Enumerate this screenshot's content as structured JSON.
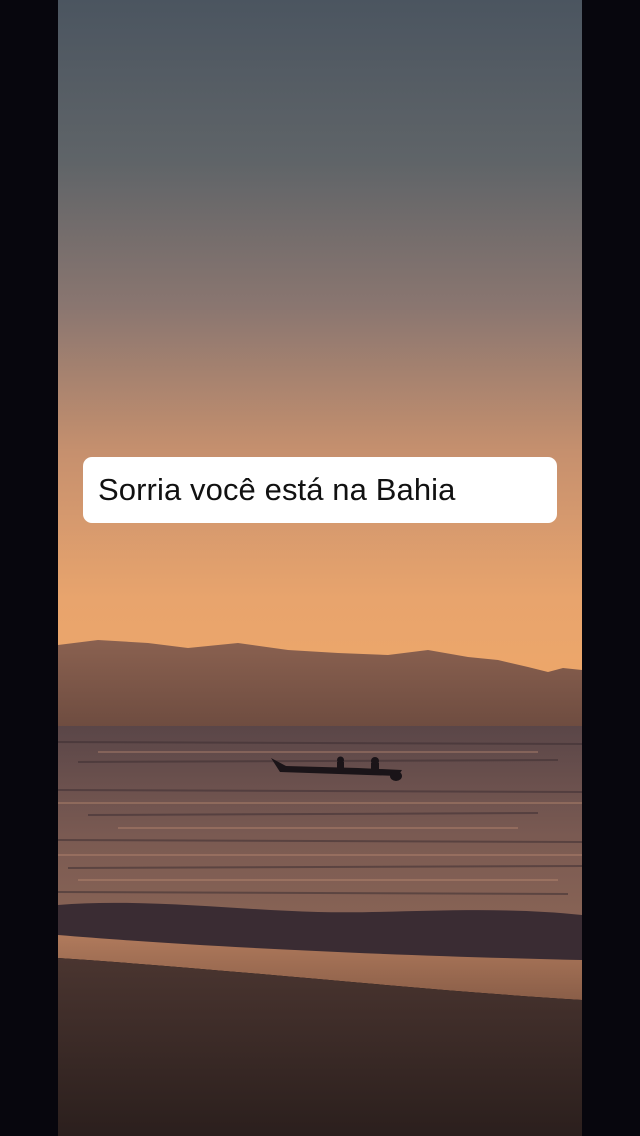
{
  "story": {
    "caption": "Sorria você está na Bahia"
  },
  "colors": {
    "letterbox": "#07060d",
    "caption_background": "#ffffff",
    "caption_text": "#111111"
  }
}
